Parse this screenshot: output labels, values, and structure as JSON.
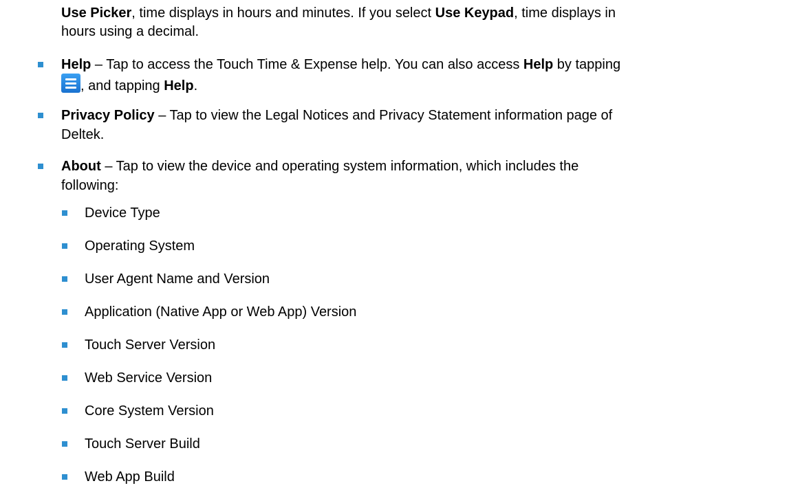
{
  "colors": {
    "bullet": "#2e8fd0",
    "menu_icon": "#1e7fdc"
  },
  "intro": {
    "line1_bold_a": "Use Picker",
    "line1_text_a": ", time displays in hours and minutes. If you select ",
    "line1_bold_b": "Use Keypad",
    "line1_text_b": ", time displays in",
    "line2_text": "hours using a decimal."
  },
  "items": [
    {
      "key": "help",
      "term": "Help",
      "line1_text_a": " – Tap to access the Touch Time & Expense help. You can also access ",
      "line1_bold_b": "Help",
      "line1_text_b": " by tapping",
      "line2_text_a": ", and tapping ",
      "line2_bold": "Help",
      "line2_text_b": ".",
      "icon": "menu-icon"
    },
    {
      "key": "privacy",
      "term": "Privacy Policy",
      "line1_text": " – Tap to view the Legal Notices and Privacy Statement information page of",
      "line2_text": "Deltek."
    },
    {
      "key": "about",
      "term": "About",
      "line1_text": " – Tap to view the device and operating system information, which includes the",
      "line2_text": "following:",
      "subitems": [
        "Device Type",
        "Operating System",
        "User Agent Name and Version",
        "Application (Native App or Web App) Version",
        "Touch Server Version",
        "Web Service Version",
        "Core System Version",
        "Touch Server Build",
        "Web App Build"
      ]
    }
  ]
}
